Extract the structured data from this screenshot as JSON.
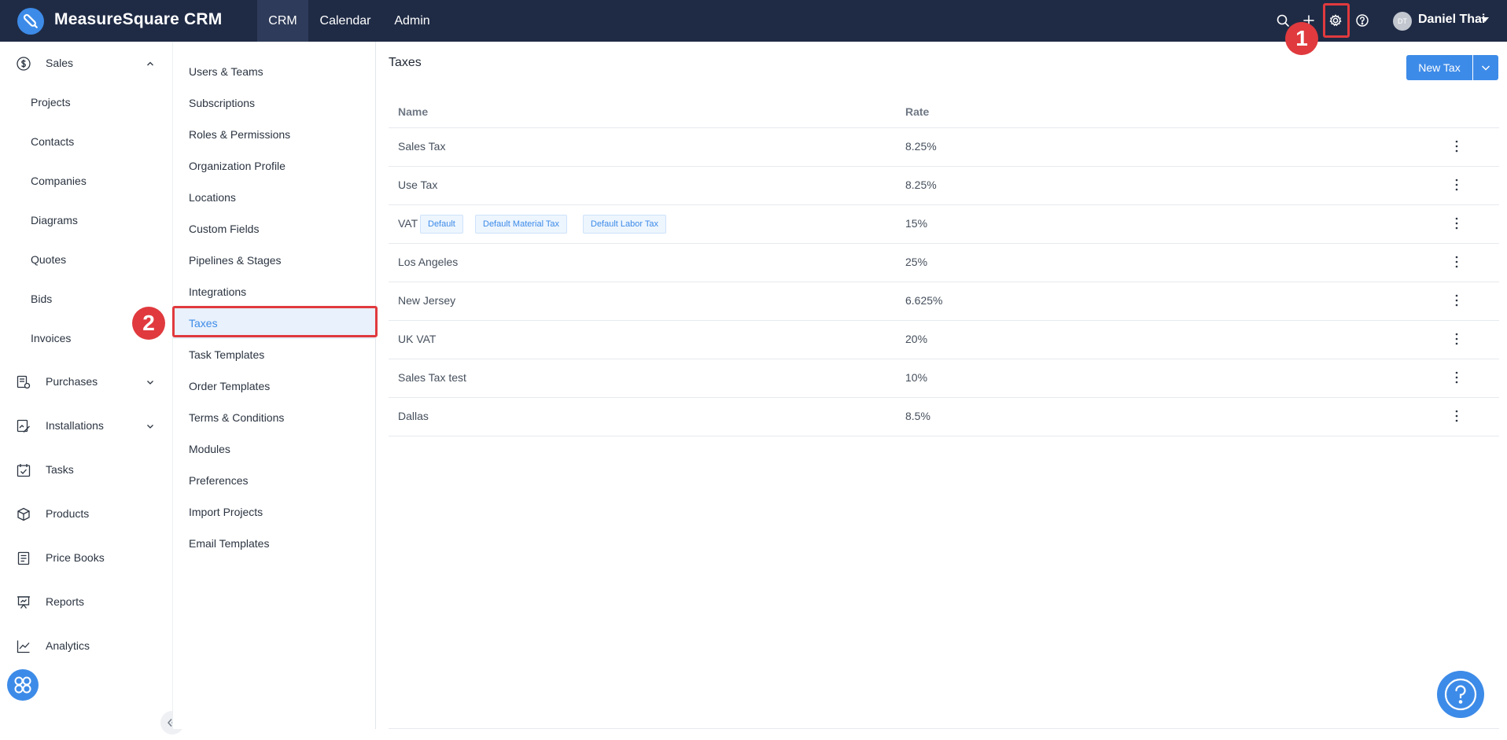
{
  "brand": {
    "name": "MeasureSquare CRM",
    "logo_icon": "pen-logo-icon"
  },
  "topnav": {
    "tabs": [
      {
        "label": "CRM",
        "active": true
      },
      {
        "label": "Calendar",
        "active": false
      },
      {
        "label": "Admin",
        "active": false
      }
    ],
    "icons": [
      "search-icon",
      "plus-icon",
      "gear-icon",
      "help-circle-icon"
    ],
    "user": {
      "initials": "DT",
      "name": "Daniel Thai"
    }
  },
  "markers": {
    "step1": "1",
    "step2": "2"
  },
  "sidebar": {
    "items": [
      {
        "label": "Sales",
        "icon": "dollar-icon",
        "expanded": true
      },
      {
        "label": "Projects"
      },
      {
        "label": "Contacts"
      },
      {
        "label": "Companies"
      },
      {
        "label": "Diagrams"
      },
      {
        "label": "Quotes"
      },
      {
        "label": "Bids"
      },
      {
        "label": "Invoices"
      },
      {
        "label": "Purchases",
        "icon": "purchase-icon",
        "expanded": false
      },
      {
        "label": "Installations",
        "icon": "installation-icon",
        "expanded": false
      },
      {
        "label": "Tasks",
        "icon": "calendar-check-icon"
      },
      {
        "label": "Products",
        "icon": "box-icon"
      },
      {
        "label": "Price Books",
        "icon": "book-icon"
      },
      {
        "label": "Reports",
        "icon": "presentation-icon"
      },
      {
        "label": "Analytics",
        "icon": "line-chart-icon"
      }
    ]
  },
  "settings_menu": {
    "items": [
      {
        "label": "Users & Teams"
      },
      {
        "label": "Subscriptions"
      },
      {
        "label": "Roles & Permissions"
      },
      {
        "label": "Organization Profile"
      },
      {
        "label": "Locations"
      },
      {
        "label": "Custom Fields"
      },
      {
        "label": "Pipelines & Stages"
      },
      {
        "label": "Integrations"
      },
      {
        "label": "Taxes",
        "active": true
      },
      {
        "label": "Task Templates"
      },
      {
        "label": "Order Templates"
      },
      {
        "label": "Terms & Conditions"
      },
      {
        "label": "Modules"
      },
      {
        "label": "Preferences"
      },
      {
        "label": "Import Projects"
      },
      {
        "label": "Email Templates"
      }
    ]
  },
  "taxes": {
    "title": "Taxes",
    "new_button": "New Tax",
    "columns": {
      "name": "Name",
      "rate": "Rate"
    },
    "rows": [
      {
        "name": "Sales Tax",
        "rate": "8.25%",
        "tags": []
      },
      {
        "name": "Use Tax",
        "rate": "8.25%",
        "tags": []
      },
      {
        "name": "VAT",
        "rate": "15%",
        "tags": [
          "Default",
          "Default Material Tax",
          "Default Labor Tax"
        ]
      },
      {
        "name": "Los Angeles",
        "rate": "25%",
        "tags": []
      },
      {
        "name": "New Jersey",
        "rate": "6.625%",
        "tags": []
      },
      {
        "name": "UK VAT",
        "rate": "20%",
        "tags": []
      },
      {
        "name": "Sales Tax test",
        "rate": "10%",
        "tags": []
      },
      {
        "name": "Dallas",
        "rate": "8.5%",
        "tags": []
      }
    ]
  },
  "colors": {
    "topbar": "#1f2b45",
    "accent": "#3d8be8",
    "marker": "#e03a3e"
  }
}
